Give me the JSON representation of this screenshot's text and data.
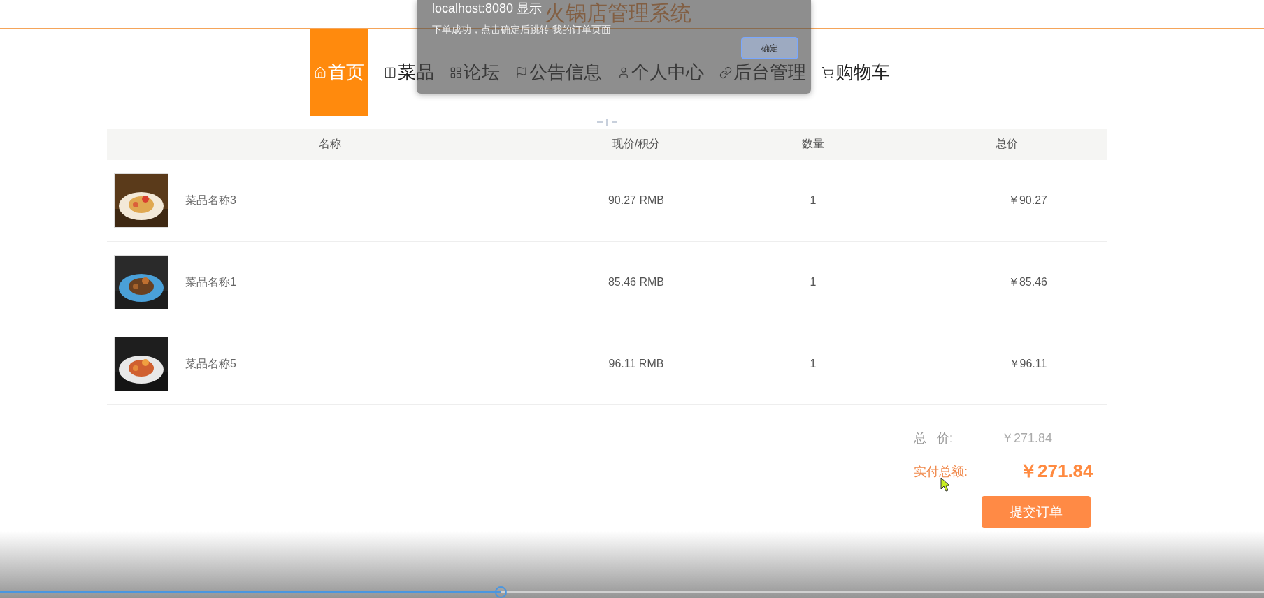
{
  "page": {
    "title": "火锅店管理系统"
  },
  "nav": [
    {
      "label": "首页",
      "selected": true,
      "kind": "home"
    },
    {
      "label": "菜品",
      "selected": false,
      "kind": "columns"
    },
    {
      "label": "论坛",
      "selected": false,
      "kind": "grid"
    },
    {
      "label": "公告信息",
      "selected": false,
      "kind": "flag"
    },
    {
      "label": "个人中心",
      "selected": false,
      "kind": "user"
    },
    {
      "label": "后台管理",
      "selected": false,
      "kind": "link"
    },
    {
      "label": "购物车",
      "selected": false,
      "kind": "cart"
    }
  ],
  "table": {
    "columns": [
      "名称",
      "现价/积分",
      "数量",
      "总价"
    ],
    "rows": [
      {
        "name": "菜品名称3",
        "price": "90.27 RMB",
        "quantity": "1",
        "total": "￥90.27"
      },
      {
        "name": "菜品名称1",
        "price": "85.46 RMB",
        "quantity": "1",
        "total": "￥85.46"
      },
      {
        "name": "菜品名称5",
        "price": "96.11 RMB",
        "quantity": "1",
        "total": "￥96.11"
      }
    ]
  },
  "summary": {
    "total_label": "总   价:",
    "total_value": "￥271.84",
    "paid_label": "实付总额:",
    "paid_value": "￥271.84",
    "submit": "提交订单"
  },
  "dialog": {
    "origin": "localhost:8080 显示",
    "message": "下单成功，点击确定后跳转 我的订单页面",
    "ok": "确定"
  },
  "player": {
    "progress": {
      "level": 0.396
    }
  }
}
